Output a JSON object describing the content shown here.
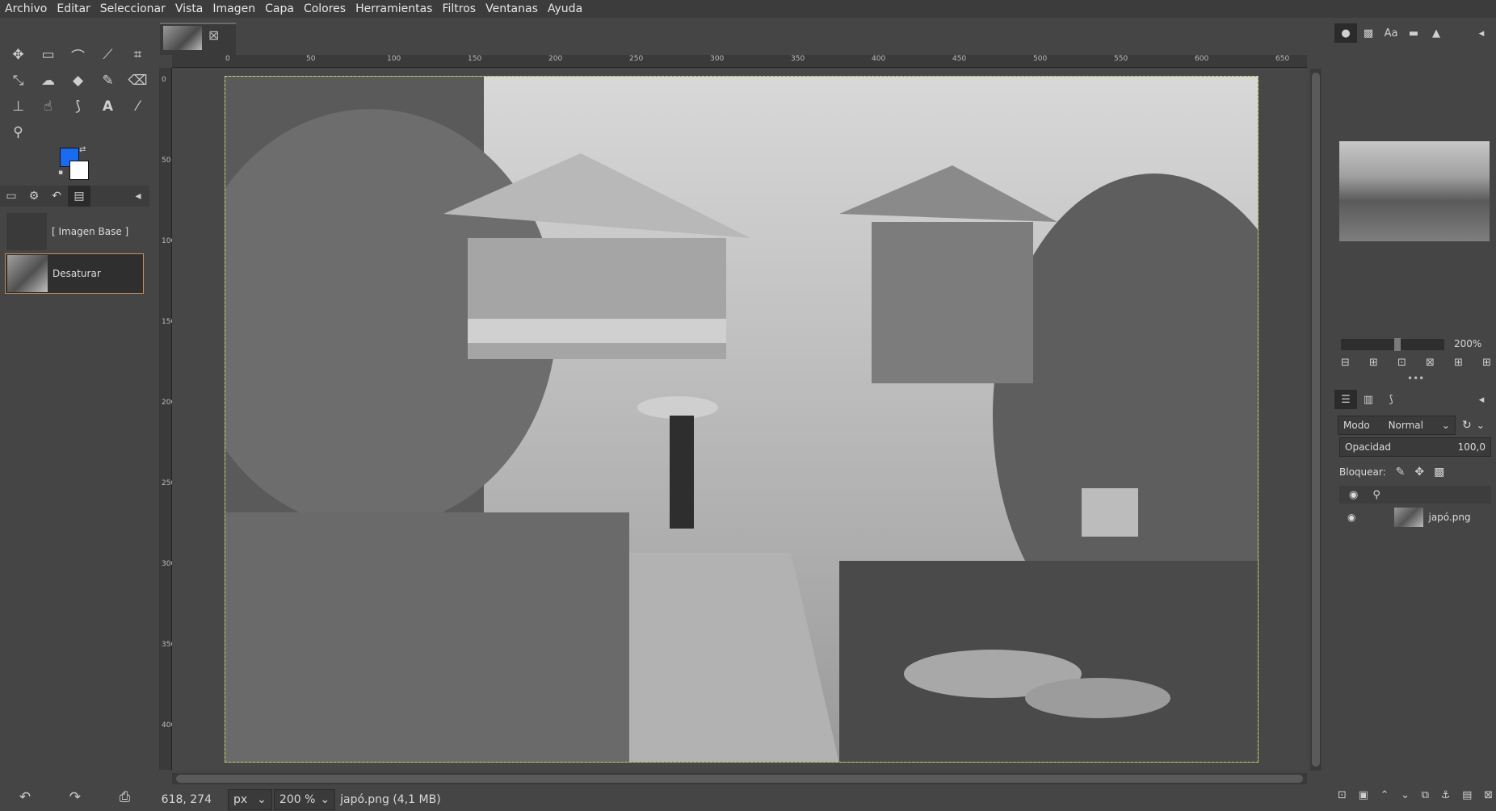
{
  "menubar": {
    "items": [
      "Archivo",
      "Editar",
      "Seleccionar",
      "Vista",
      "Imagen",
      "Capa",
      "Colores",
      "Herramientas",
      "Filtros",
      "Ventanas",
      "Ayuda"
    ]
  },
  "toolbox": {
    "tools_row1": [
      "move-tool-icon",
      "rect-select-icon",
      "lasso-icon",
      "fuzzy-select-icon",
      "crop-icon"
    ],
    "tools_row2": [
      "unified-transform-icon",
      "warp-icon",
      "bucket-fill-icon",
      "paintbrush-icon",
      "eraser-icon"
    ],
    "tools_row3": [
      "clone-icon",
      "smudge-icon",
      "paths-icon",
      "text-icon",
      "color-picker-icon"
    ],
    "tools_row4": [
      "zoom-icon"
    ],
    "foreground_color": "#1a6bf0",
    "background_color": "#ffffff"
  },
  "undo_history": {
    "items": [
      {
        "label": "[ Imagen Base ]"
      },
      {
        "label": "Desaturar"
      }
    ]
  },
  "image_tab": {
    "name": "japó.png"
  },
  "ruler": {
    "h_labels": [
      "0",
      "50",
      "100",
      "150",
      "200",
      "250",
      "300",
      "350",
      "400",
      "450",
      "500",
      "550",
      "600",
      "650"
    ],
    "v_labels": [
      "0",
      "50",
      "100",
      "150",
      "200",
      "250",
      "300",
      "350",
      "400"
    ]
  },
  "statusbar": {
    "coords": "618, 274",
    "unit": "px",
    "zoom": "200 %",
    "file_info": "japó.png (4,1 MB)"
  },
  "navigator": {
    "zoom_label": "200%",
    "zoom_fraction": 0.5
  },
  "layers": {
    "mode_label": "Modo",
    "mode_value": "Normal",
    "opacity_label": "Opacidad",
    "opacity_value": "100,0",
    "lock_label": "Bloquear:",
    "items": [
      {
        "name": "japó.png",
        "visible": true
      }
    ]
  }
}
